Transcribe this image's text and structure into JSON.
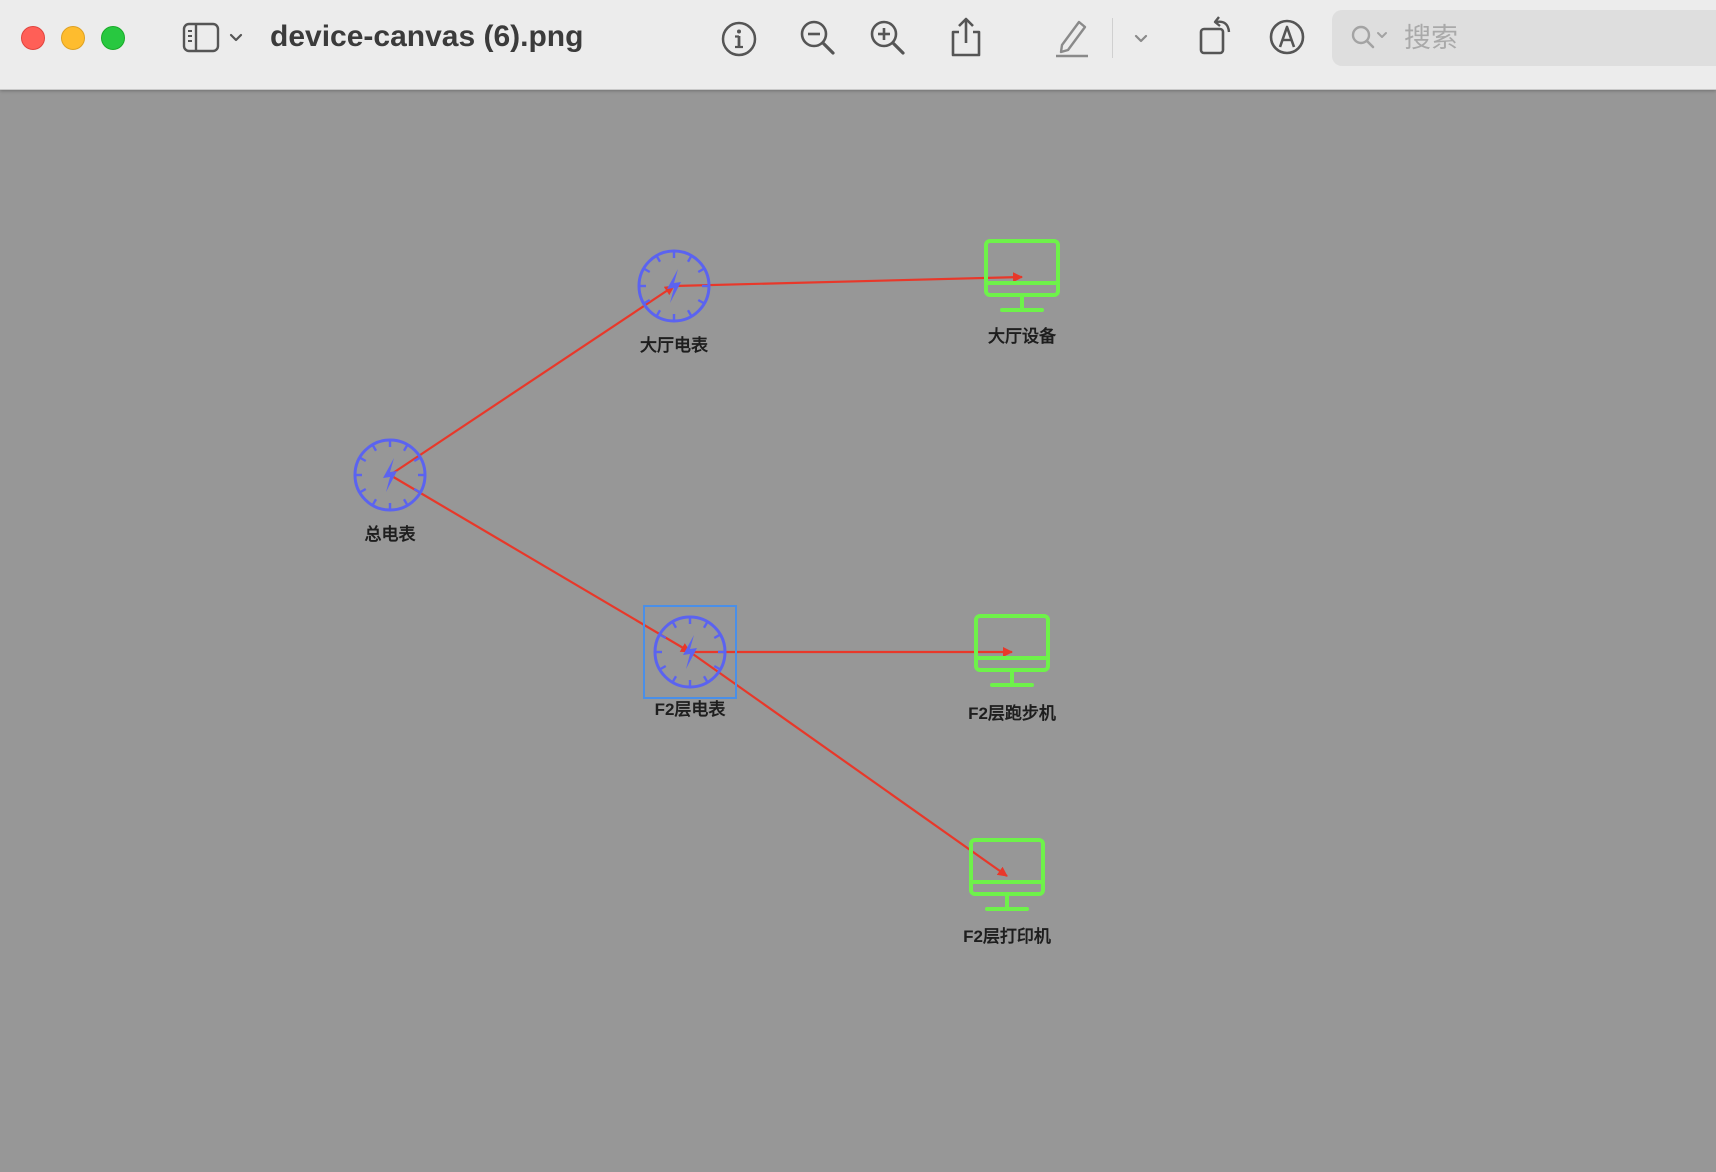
{
  "window": {
    "title": "device-canvas (6).png",
    "search_placeholder": "搜索"
  },
  "toolbar": {
    "icons": [
      "sidebar-icon",
      "chevron-down-icon",
      "info-icon",
      "zoom-out-icon",
      "zoom-in-icon",
      "share-icon",
      "highlight-pen-icon",
      "chevron-down-icon",
      "rotate-icon",
      "markup-icon",
      "search-icon"
    ]
  },
  "colors": {
    "meter": "#5b63f0",
    "device": "#6ef24a",
    "edge": "#e8382a",
    "selection": "#4a8fe8",
    "canvas_bg": "#979797"
  },
  "diagram": {
    "nodes": [
      {
        "id": "main-meter",
        "label": "总电表",
        "kind": "meter-icon"
      },
      {
        "id": "hall-meter",
        "label": "大厅电表",
        "kind": "meter-icon"
      },
      {
        "id": "hall-device",
        "label": "大厅设备",
        "kind": "monitor-icon"
      },
      {
        "id": "f2-meter",
        "label": "F2层电表",
        "kind": "meter-icon",
        "selected": true
      },
      {
        "id": "f2-treadmill",
        "label": "F2层跑步机",
        "kind": "monitor-icon"
      },
      {
        "id": "f2-printer",
        "label": "F2层打印机",
        "kind": "monitor-icon"
      }
    ],
    "edges": [
      {
        "from": "main-meter",
        "to": "hall-meter"
      },
      {
        "from": "main-meter",
        "to": "f2-meter"
      },
      {
        "from": "hall-meter",
        "to": "hall-device"
      },
      {
        "from": "f2-meter",
        "to": "f2-treadmill"
      },
      {
        "from": "f2-meter",
        "to": "f2-printer"
      }
    ]
  }
}
